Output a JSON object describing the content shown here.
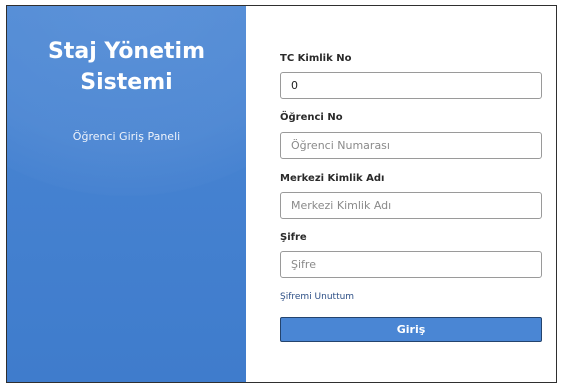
{
  "brand": {
    "title_line1": "Staj Yönetim",
    "title_line2": "Sistemi",
    "subtitle": "Öğrenci Giriş Paneli",
    "accent_color": "#4a86d4"
  },
  "form": {
    "tc_kimlik": {
      "label": "TC Kimlik No",
      "value": "0"
    },
    "ogrenci_no": {
      "label": "Öğrenci No",
      "placeholder": "Öğrenci Numarası"
    },
    "merkezi_kimlik": {
      "label": "Merkezi Kimlik Adı",
      "placeholder": "Merkezi Kimlik Adı"
    },
    "sifre": {
      "label": "Şifre",
      "placeholder": "Şifre"
    },
    "forgot_password": "Şifremi Unuttum",
    "submit_label": "Giriş"
  }
}
